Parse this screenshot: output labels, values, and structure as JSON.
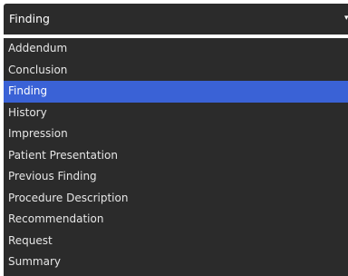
{
  "select": {
    "value": "Finding",
    "icon": "chevron-down-icon"
  },
  "options": [
    "Addendum",
    "Conclusion",
    "Finding",
    "History",
    "Impression",
    "Patient Presentation",
    "Previous Finding",
    "Procedure Description",
    "Recommendation",
    "Request",
    "Summary"
  ],
  "selected_option": "Finding",
  "colors": {
    "panel": "#2b2b2b",
    "highlight": "#3a62d6",
    "text": "#e6e6e6"
  }
}
